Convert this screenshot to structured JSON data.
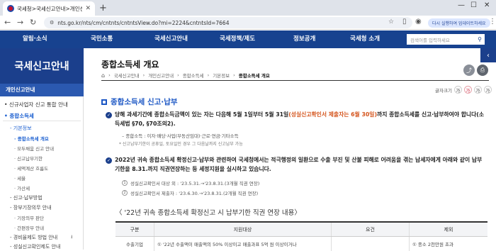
{
  "browser": {
    "tab_title": "국세청>국세신고안내>개인신고안내",
    "url": "nts.go.kr/nts/cm/cntnts/cntntsView.do?mi=2224&cntntsId=7664",
    "update_label": "다시 실행하여 업데이트하세요"
  },
  "gnb": {
    "items": [
      "알림·소식",
      "국민소통",
      "국세신고안내",
      "국세정책/제도",
      "정보공개",
      "국세청 소개"
    ],
    "search_placeholder": "검색어를 입력하세요"
  },
  "sidebar": {
    "heading": "국세신고안내",
    "section": "개인신고안내",
    "items": [
      "신규사업자 신고 통합 안내",
      "종합소득세",
      "기본정보",
      "종합소득세 개요",
      "모두채움 신고 안내",
      "신고납부기한",
      "세액계산 흐름도",
      "세율",
      "가산세",
      "신고·납부방법",
      "장부기장의무 안내",
      "기장의무 판단",
      "간편장부 안내",
      "경비율제도 방법 안내",
      "성실신고확인제도 안내"
    ]
  },
  "main": {
    "title": "종합소득세 개요",
    "breadcrumb": [
      "국세신고안내",
      "개인신고안내",
      "종합소득세",
      "기본정보",
      "종합소득세 개요"
    ],
    "font_size_label": "글자크기",
    "font_buttons": [
      "가",
      "가",
      "가",
      "가"
    ],
    "section_title": "종합소득세 신고·납부",
    "para1_a": "당해 과세기간에 종합소득금액이 있는 자는 다음해 5월 1일부터 5월 31일",
    "para1_em": "(성실신고확인서 제출자는 6월 30일)",
    "para1_b": "까지 종합소득세를 신고·납부하여야 합니다(소득세법 §70, §70조의2).",
    "sub1": "– 종합소득 : 이자·배당·사업(부동산임대)·근로·연금·기타소득",
    "sub2": "* 신고납부기한이 공휴일, 토요일인 경우 그 다음날까지 신고납부 가능",
    "para2": "2022년 귀속 종합소득세 확정신고·납부와 관련하여 국세청에서는 적극행정의 일환으로 수출 부진 및 산불 피해로 어려움을 겪는 납세자에게 아래와 같이 납부기한을 8.31.까지 직권연장하는 등 세정지원을 실시하고 있습니다.",
    "num_items": [
      {
        "n": "1",
        "text": "성실신고확인서 대상 외 : '23.5.31.→'23.8.31.(3개월 직권 연장)"
      },
      {
        "n": "2",
        "text": "성실신고확인서 제출자 : '23.6.30.→'23.8.31.(2개월 직권 연장)"
      }
    ],
    "table_title": "〈 '22년 귀속 종합소득세 확정신고 시 납부기한 직권 연장 내용〉",
    "table_headers": [
      "구분",
      "지원대상",
      "요건",
      "제외"
    ],
    "table_row": [
      "수출기업",
      "① '22년 수출액이 매출액의 50% 이상이고 매출과표 5억 원 이상이거나",
      "",
      "① 종소 2천만원 초과"
    ]
  }
}
